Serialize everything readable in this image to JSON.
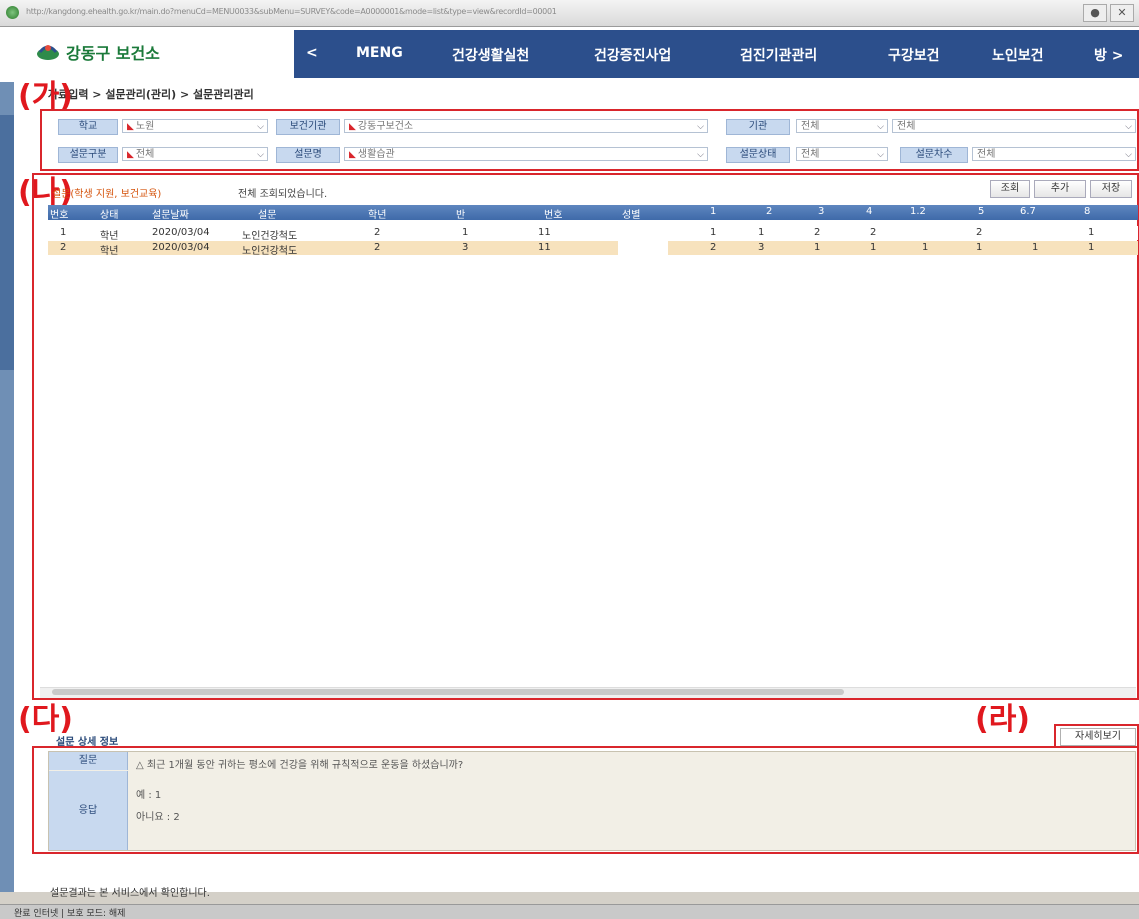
{
  "browser": {
    "url": "http://kangdong.ehealth.go.kr/main.do?menuCd=MENU0033&subMenu=SURVEY&code=A0000001&mode=list&type=view&recordId=00001",
    "window_buttons": [
      "●",
      "✕"
    ]
  },
  "app": {
    "logo_text": "강동구 보건소",
    "nav_prev": "<",
    "nav_items": [
      "MENG",
      "건강생활실천",
      "건강증진사업",
      "검진기관관리",
      "구강보건",
      "노인보건"
    ],
    "nav_next": "방 >"
  },
  "breadcrumb": "자료입력 > 설문관리(관리) > 설문관리관리",
  "markers": {
    "ga": "(가)",
    "na": "(나)",
    "da": "(다)",
    "ra": "(라)"
  },
  "filters": {
    "row1": [
      {
        "label": "학교",
        "value": "노원",
        "required": true
      },
      {
        "label": "보건기관",
        "value": "강동구보건소",
        "required": true
      },
      {
        "label": "기관",
        "value": "전체"
      },
      {
        "label": "",
        "value": "전체"
      }
    ],
    "row2": [
      {
        "label": "설문구분",
        "value": "전체",
        "required": true
      },
      {
        "label": "설문명",
        "value": "생활습관",
        "required": true
      },
      {
        "label": "설문상태",
        "value": "전체"
      },
      {
        "label": "설문차수",
        "value": "전체"
      }
    ]
  },
  "grid": {
    "title": "설문(학생 지원, 보건교육)",
    "hint": "전체 조회되었습니다.",
    "buttons": [
      "조회",
      "추가",
      "저장"
    ],
    "columns": [
      "번호",
      "상태",
      "설문날짜",
      "설문",
      "학년",
      "반",
      "번호",
      "성별",
      "1",
      "2",
      "3",
      "4",
      "1.2",
      "5",
      "6.7",
      "8"
    ],
    "rows": [
      [
        "1",
        "학년",
        "2020/03/04",
        "노인건강척도",
        "2",
        "1",
        "11",
        "",
        "1",
        "1",
        "2",
        "2",
        "",
        "2",
        "",
        "1"
      ],
      [
        "2",
        "학년",
        "2020/03/04",
        "노인건강척도",
        "2",
        "3",
        "11",
        "",
        "2",
        "3",
        "1",
        "1",
        "1",
        "1",
        "1",
        "1"
      ]
    ]
  },
  "detail": {
    "title": "설문 상세 정보",
    "button": "자세히보기",
    "rows": [
      {
        "label": "질문",
        "text": "△ 최근 1개월 동안 귀하는 평소에 건강을 위해 규칙적으로 운동을 하셨습니까?"
      },
      {
        "label": "응답",
        "lines": [
          "예 : 1",
          "아니요 : 2"
        ]
      }
    ]
  },
  "footer_text": "설문결과는 본 서비스에서 확인합니다.",
  "statusbar": "완료 인터넷 | 보호 모드: 해제"
}
